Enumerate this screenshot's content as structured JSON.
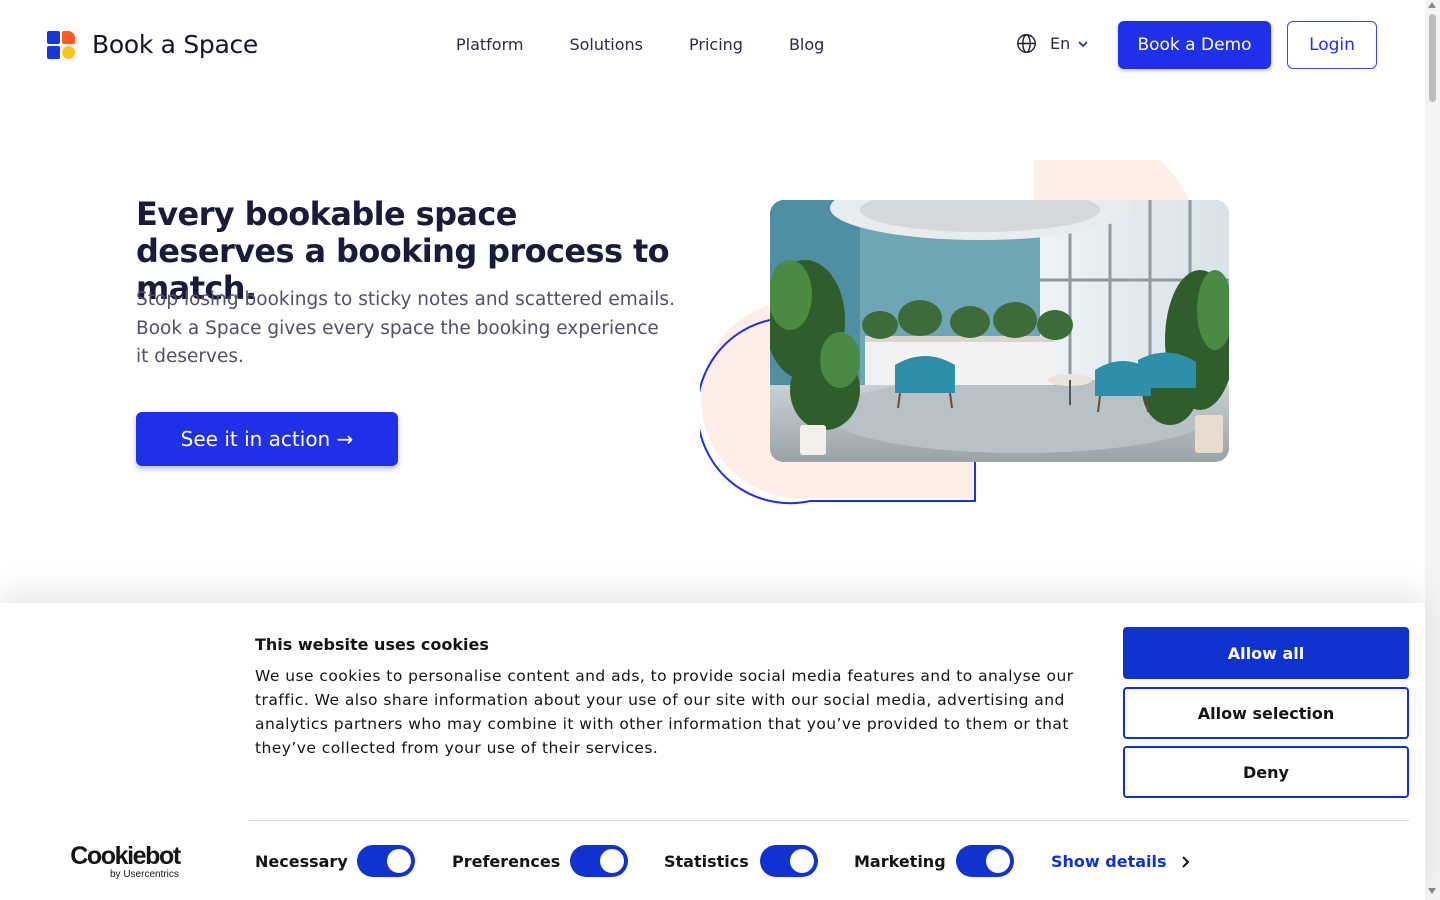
{
  "header": {
    "logo_text": "Book a Space",
    "nav": [
      "Platform",
      "Solutions",
      "Pricing",
      "Blog"
    ],
    "language": "En",
    "demo_button": "Book a Demo",
    "login_button": "Login"
  },
  "hero": {
    "title": "Every bookable space deserves a booking process to match.",
    "subtitle": "Stop losing bookings to sticky notes and scattered emails. Book a Space gives every space the booking experience it deserves.",
    "cta": "See it in action →"
  },
  "cookie_banner": {
    "title": "This website uses cookies",
    "body": "We use cookies to personalise content and ads, to provide social media features and to analyse our traffic. We also share information about your use of our site with our social media, advertising and analytics partners who may combine it with other information that you’ve provided to them or that they’ve collected from your use of their services.",
    "allow_all": "Allow all",
    "allow_selection": "Allow selection",
    "deny": "Deny",
    "brand_main": "Cookiebot",
    "brand_sub": "by Usercentrics",
    "toggles": [
      {
        "label": "Necessary",
        "on": true
      },
      {
        "label": "Preferences",
        "on": true
      },
      {
        "label": "Statistics",
        "on": true
      },
      {
        "label": "Marketing",
        "on": true
      }
    ],
    "show_details": "Show details"
  },
  "colors": {
    "brand_blue": "#1f30e8",
    "cookie_blue": "#1032cf",
    "peach": "#fdeee8",
    "logo_orange": "#ff5a1f",
    "logo_yellow": "#ffc21a"
  },
  "icons": [
    "globe-icon",
    "chevron-down-icon",
    "chevron-right-icon"
  ]
}
